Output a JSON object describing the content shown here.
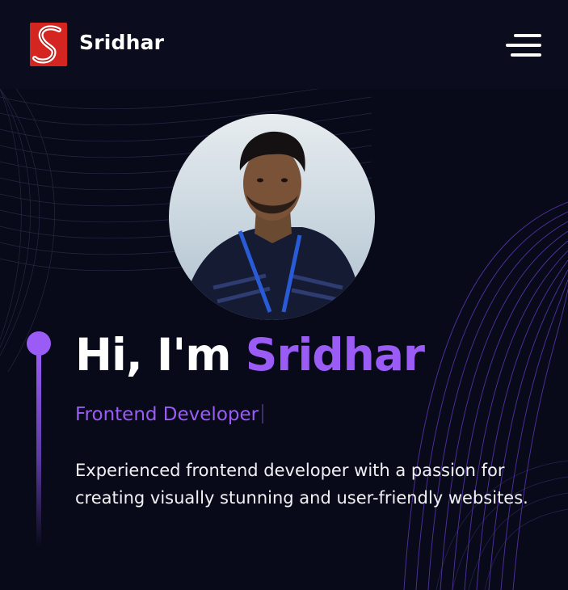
{
  "header": {
    "logo_letter": "S",
    "brand": "Sridhar",
    "menu_icon": "hamburger-menu-icon"
  },
  "hero": {
    "greeting": "Hi, I'm",
    "name": "Sridhar",
    "role": "Frontend Developer",
    "description": "Experienced frontend developer with a passion for creating visually stunning and user-friendly websites."
  },
  "colors": {
    "background": "#080a1a",
    "accent": "#9b5cf6",
    "logo_bg": "#d42520"
  }
}
